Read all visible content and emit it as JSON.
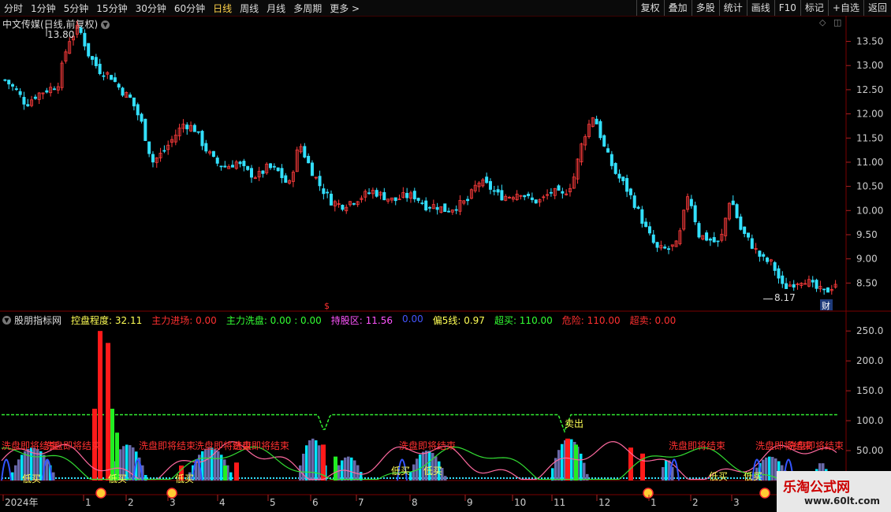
{
  "toolbar": {
    "periods": [
      "分时",
      "1分钟",
      "5分钟",
      "15分钟",
      "30分钟",
      "60分钟",
      "日线",
      "周线",
      "月线",
      "多周期",
      "更多 >"
    ],
    "active_period": "日线",
    "actions": [
      "复权",
      "叠加",
      "多股",
      "统计",
      "画线",
      "F10",
      "标记",
      "+自选",
      "返回"
    ]
  },
  "stock": {
    "title": "中文传媒(日线,前复权)",
    "high_label": "13.80",
    "low_label": "8.17",
    "event_badge": "财",
    "dividend_marker": "$"
  },
  "price_axis": {
    "labels": [
      "13.50",
      "13.00",
      "12.50",
      "12.00",
      "11.50",
      "11.00",
      "10.50",
      "10.00",
      "9.50",
      "9.00",
      "8.50"
    ]
  },
  "indicator": {
    "name": "股朋指标网",
    "items": [
      {
        "label": "控盘程度: 32.11",
        "color": "#ffff55"
      },
      {
        "label": "主力进场: 0.00",
        "color": "#ff3030"
      },
      {
        "label": "主力洗盘: 0.00 : 0.00",
        "color": "#33ff33"
      },
      {
        "label": "持股区: 11.56",
        "color": "#ff55ff"
      },
      {
        "label": "0.00",
        "color": "#4455ff"
      },
      {
        "label": "偏5线: 0.97",
        "color": "#ffff55"
      },
      {
        "label": "超买: 110.00",
        "color": "#33ff33"
      },
      {
        "label": "危险: 110.00",
        "color": "#ff3030"
      },
      {
        "label": "超卖: 0.00",
        "color": "#ff3030"
      }
    ],
    "axis_labels": [
      "250.0",
      "200.0",
      "150.0",
      "100.0",
      "50.00"
    ],
    "texts": {
      "wash_end": "洗盘即将结束",
      "low_buy": "低买",
      "sell": "卖出"
    }
  },
  "time_axis": {
    "labels": [
      "2024年",
      "1",
      "2",
      "3",
      "4",
      "5",
      "6",
      "7",
      "8",
      "9",
      "10",
      "11",
      "12",
      "1",
      "2",
      "3"
    ]
  },
  "watermark": {
    "title": "乐淘公式网",
    "url": "www.60lt.com"
  },
  "chart_data": {
    "type": "candlestick",
    "title": "中文传媒(日线,前复权)",
    "y_range": [
      8.0,
      13.9
    ],
    "x_labels": [
      "2024年",
      "1",
      "2",
      "3",
      "4",
      "5",
      "6",
      "7",
      "8",
      "9",
      "10",
      "11",
      "12",
      "1",
      "2",
      "3"
    ],
    "period_high": 13.8,
    "period_low": 8.17,
    "close_path": [
      12.7,
      12.5,
      12.2,
      12.4,
      12.5,
      12.6,
      13.5,
      13.8,
      13.2,
      12.9,
      12.8,
      12.5,
      12.3,
      11.8,
      11.0,
      11.2,
      11.5,
      11.8,
      11.7,
      11.3,
      11.0,
      10.9,
      11.0,
      10.8,
      10.7,
      10.9,
      10.8,
      10.5,
      11.4,
      10.9,
      10.5,
      10.2,
      10.1,
      10.2,
      10.3,
      10.4,
      10.3,
      10.2,
      10.3,
      10.3,
      10.1,
      10.1,
      10.0,
      10.1,
      10.2,
      10.6,
      10.5,
      10.3,
      10.3,
      10.4,
      10.2,
      10.2,
      10.4,
      10.3,
      10.6,
      11.5,
      12.0,
      11.3,
      10.8,
      10.5,
      10.1,
      9.6,
      9.2,
      9.2,
      9.3,
      10.4,
      9.5,
      9.4,
      9.3,
      10.3,
      9.6,
      9.3,
      9.0,
      8.9,
      8.4,
      8.5,
      8.6,
      8.4,
      8.3,
      8.5
    ]
  }
}
